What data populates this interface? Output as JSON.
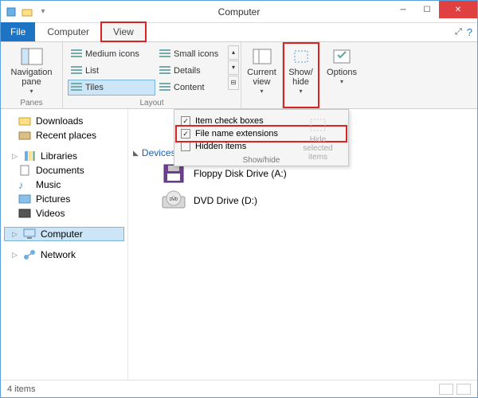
{
  "window": {
    "title": "Computer"
  },
  "tabs": {
    "file": "File",
    "computer": "Computer",
    "view": "View"
  },
  "ribbon": {
    "panes_group": "Panes",
    "nav_pane": "Navigation\npane",
    "layout_group": "Layout",
    "layout": {
      "medium": "Medium icons",
      "small": "Small icons",
      "list": "List",
      "details": "Details",
      "tiles": "Tiles",
      "content": "Content"
    },
    "current_view": "Current\nview",
    "show_hide": "Show/\nhide",
    "options": "Options"
  },
  "popup": {
    "item_check": "Item check boxes",
    "file_ext": "File name extensions",
    "hidden": "Hidden items",
    "hide_sel": "Hide selected items",
    "label": "Show/hide",
    "checked": {
      "item_check": true,
      "file_ext": true,
      "hidden": false
    }
  },
  "nav": {
    "downloads": "Downloads",
    "recent": "Recent places",
    "libraries": "Libraries",
    "documents": "Documents",
    "music": "Music",
    "pictures": "Pictures",
    "videos": "Videos",
    "computer": "Computer",
    "network": "Network"
  },
  "content": {
    "section": "Devices with Removable Storage (2)",
    "floppy": "Floppy Disk Drive (A:)",
    "dvd": "DVD Drive (D:)"
  },
  "status": {
    "count": "4 items"
  }
}
